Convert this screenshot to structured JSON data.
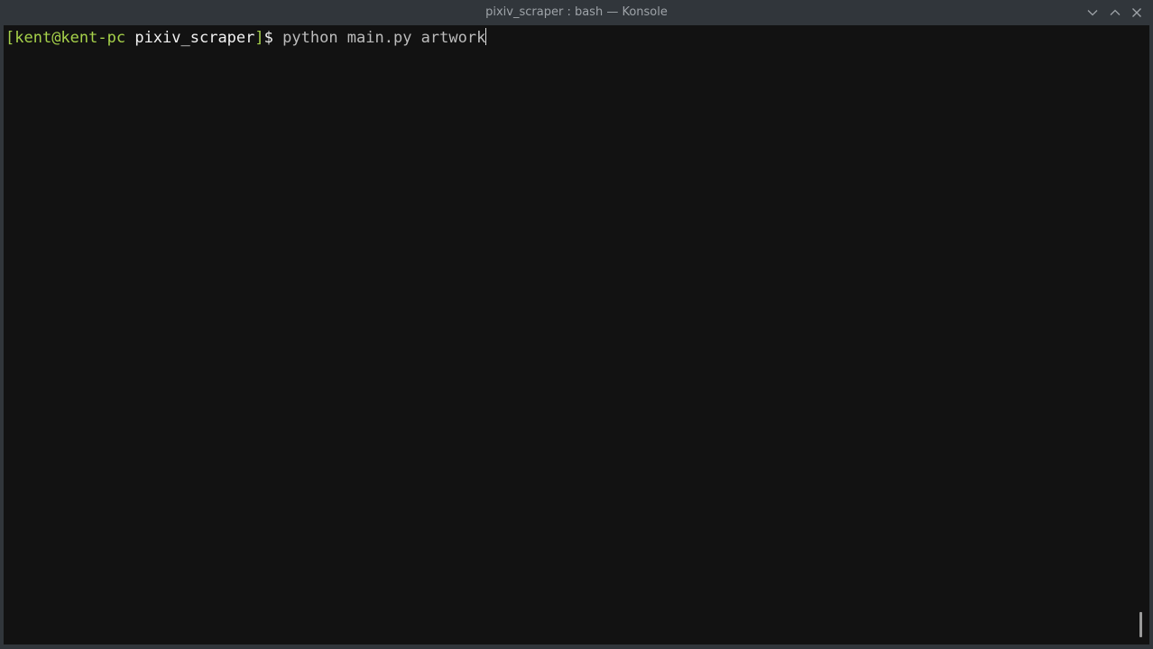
{
  "window": {
    "title": "pixiv_scraper : bash — Konsole"
  },
  "terminal": {
    "prompt": {
      "open_bracket": "[",
      "user_host": "kent@kent-pc",
      "directory": "pixiv_scraper",
      "close_bracket": "]",
      "symbol": "$"
    },
    "command": "python main.py artwork"
  },
  "colors": {
    "prompt_green": "#a6d14a",
    "directory_white": "#f2f2f2",
    "command_gray": "#bcbcbc",
    "terminal_background": "#121212",
    "titlebar_background": "#31363b"
  },
  "icons": {
    "minimize": "chevron-down-icon",
    "maximize": "chevron-up-icon",
    "close": "close-icon"
  }
}
